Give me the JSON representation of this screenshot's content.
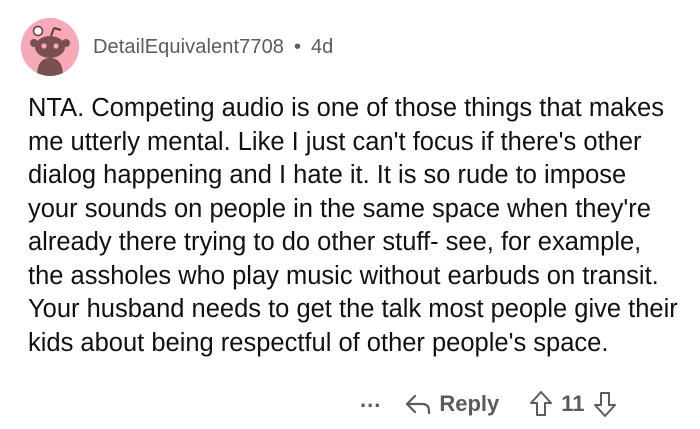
{
  "comment": {
    "author": "DetailEquivalent7708",
    "separator": "•",
    "age": "4d",
    "body": "NTA. Competing audio is one of those things that makes me utterly mental. Like I just can't focus if there's other dialog happening and I hate it. It is so rude to impose your sounds on people in the same space when they're already there trying to do other stuff- see, for example, the assholes who play music without earbuds on transit. Your husband needs to get the talk most people give their kids about being respectful of other people's space.",
    "avatar_icon": "reddit-snoo-avatar-icon",
    "avatar_color": "#f7a9b8"
  },
  "actions": {
    "more_label": "...",
    "reply_label": "Reply",
    "reply_icon": "reply-arrow-icon",
    "upvote_icon": "upvote-arrow-icon",
    "downvote_icon": "downvote-arrow-icon",
    "score": "11"
  }
}
